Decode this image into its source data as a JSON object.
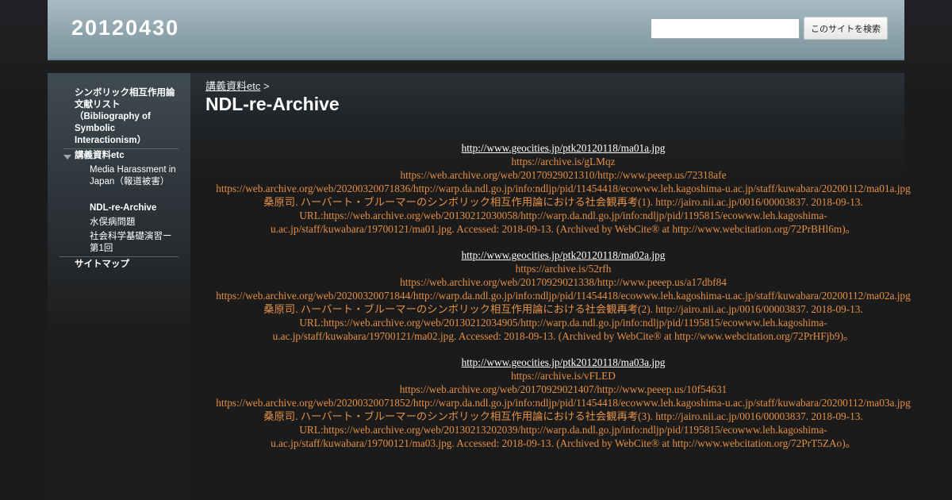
{
  "header": {
    "site_title": "20120430",
    "search": {
      "placeholder": "",
      "value": "",
      "button_label": "このサイトを検索"
    }
  },
  "sidebar": {
    "items": [
      {
        "label": "シンボリック相互作用論文献リスト（Bibliography of Symbolic Interactionism）"
      },
      {
        "label": "講義資料etc"
      },
      {
        "label": "Media Harassment in Japan（報道被害）"
      },
      {
        "label": "NDL-re-Archive"
      },
      {
        "label": "水俣病問題"
      },
      {
        "label": "社会科学基礎演習ー第1回"
      },
      {
        "label": "サイトマップ"
      }
    ]
  },
  "main": {
    "breadcrumb": {
      "link": "講義資料etc",
      "separator": ">"
    },
    "title": "NDL-re-Archive",
    "entries": [
      {
        "original": "http://www.geocities.jp/ptk20120118/ma01a.jpg",
        "archive_is": "https://archive.is/gLMqz",
        "wayback_peeep": "https://web.archive.org/web/20170929021310/http://www.peeep.us/72318afe",
        "wayback_ndl": "https://web.archive.org/web/20200320071836/http://warp.da.ndl.go.jp/info:ndljp/pid/11454418/ecowww.leh.kagoshima-u.ac.jp/staff/kuwabara/20200112/ma01a.jpg",
        "reference": "桑原司. ハーバート・ブルーマーのシンボリック相互作用論における社会観再考(1). http://jairo.nii.ac.jp/0016/00003837. 2018-09-13. URL:https://web.archive.org/web/20130212030058/http://warp.da.ndl.go.jp/info:ndljp/pid/1195815/ecowww.leh.kagoshima-u.ac.jp/staff/kuwabara/19700121/ma01.jpg. Accessed: 2018-09-13. (Archived by WebCite® at http://www.webcitation.org/72PrBHl6m)。"
      },
      {
        "original": "http://www.geocities.jp/ptk20120118/ma02a.jpg",
        "archive_is": "https://archive.is/52rfh",
        "wayback_peeep": "https://web.archive.org/web/20170929021338/http://www.peeep.us/a17dbf84",
        "wayback_ndl": "https://web.archive.org/web/20200320071844/http://warp.da.ndl.go.jp/info:ndljp/pid/11454418/ecowww.leh.kagoshima-u.ac.jp/staff/kuwabara/20200112/ma02a.jpg",
        "reference": "桑原司. ハーバート・ブルーマーのシンボリック相互作用論における社会観再考(2). http://jairo.nii.ac.jp/0016/00003837. 2018-09-13. URL:https://web.archive.org/web/20130212034905/http://warp.da.ndl.go.jp/info:ndljp/pid/1195815/ecowww.leh.kagoshima-u.ac.jp/staff/kuwabara/19700121/ma02.jpg. Accessed: 2018-09-13. (Archived by WebCite® at http://www.webcitation.org/72PrHFjb9)。"
      },
      {
        "original": "http://www.geocities.jp/ptk20120118/ma03a.jpg",
        "archive_is": "https://archive.is/vFLED",
        "wayback_peeep": "https://web.archive.org/web/20170929021407/http://www.peeep.us/10f54631",
        "wayback_ndl": "https://web.archive.org/web/20200320071852/http://warp.da.ndl.go.jp/info:ndljp/pid/11454418/ecowww.leh.kagoshima-u.ac.jp/staff/kuwabara/20200112/ma03a.jpg",
        "reference": "桑原司. ハーバート・ブルーマーのシンボリック相互作用論における社会観再考(3). http://jairo.nii.ac.jp/0016/00003837. 2018-09-13. URL:https://web.archive.org/web/20130213202039/http://warp.da.ndl.go.jp/info:ndljp/pid/1195815/ecowww.leh.kagoshima-u.ac.jp/staff/kuwabara/19700121/ma03.jpg. Accessed: 2018-09-13. (Archived by WebCite® at http://www.webcitation.org/72PrT5ZAo)。"
      }
    ]
  },
  "colors": {
    "link_orange": "#e38f45",
    "header_bg": "#9bb0b8"
  }
}
